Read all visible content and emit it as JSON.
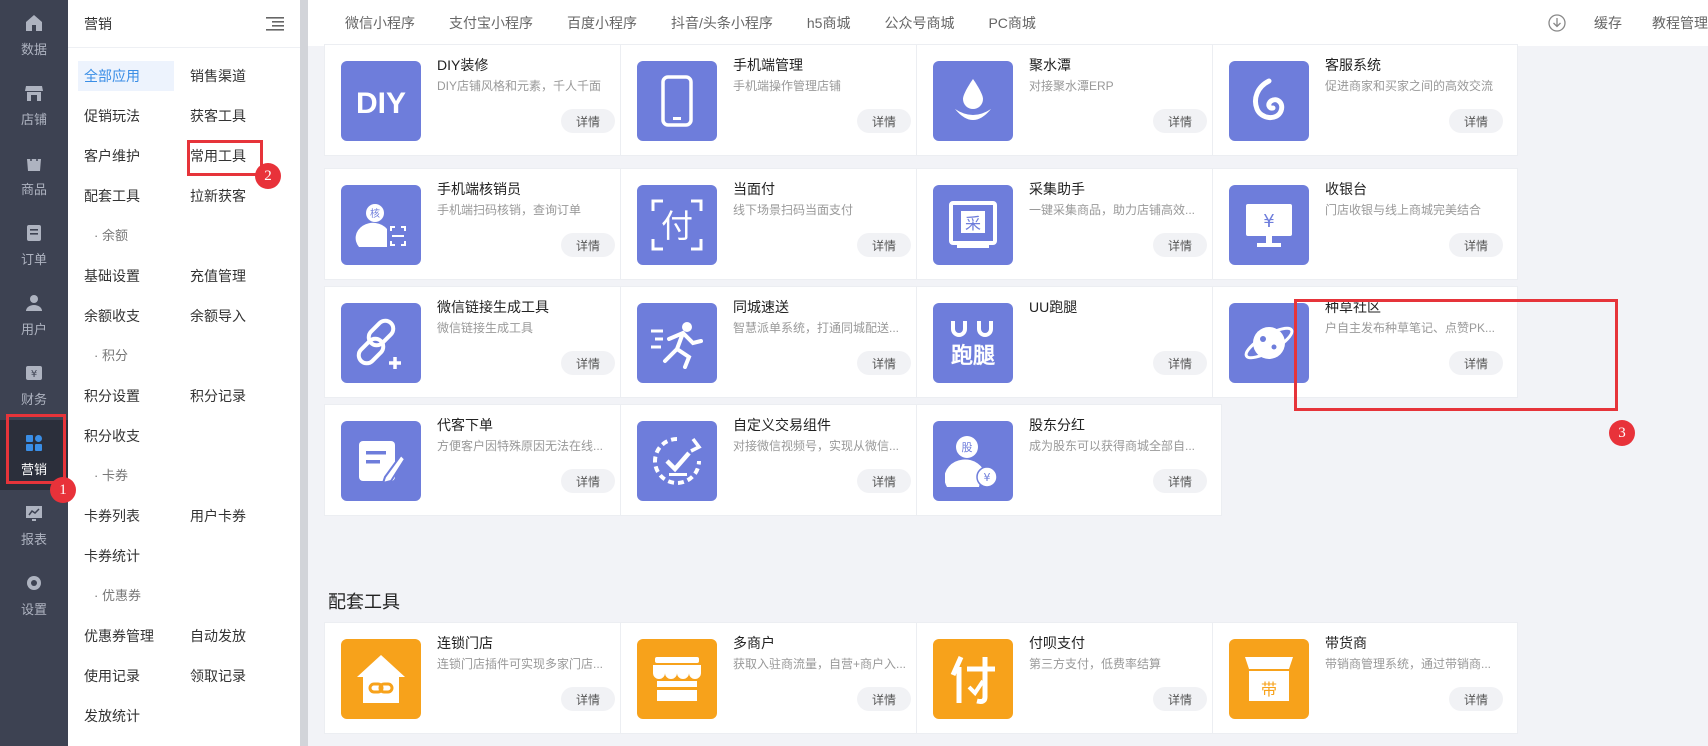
{
  "rail": {
    "items": [
      {
        "label": "数据",
        "icon": "home-icon"
      },
      {
        "label": "店铺",
        "icon": "store-icon"
      },
      {
        "label": "商品",
        "icon": "bag-icon"
      },
      {
        "label": "订单",
        "icon": "order-icon"
      },
      {
        "label": "用户",
        "icon": "user-icon"
      },
      {
        "label": "财务",
        "icon": "finance-icon"
      },
      {
        "label": "营销",
        "icon": "apps-icon",
        "active": true
      },
      {
        "label": "报表",
        "icon": "report-icon"
      },
      {
        "label": "设置",
        "icon": "gear-icon"
      }
    ]
  },
  "submenu": {
    "title": "营销",
    "rows": [
      [
        "全部应用",
        "销售渠道"
      ],
      [
        "促销玩法",
        "获客工具"
      ],
      [
        "客户维护",
        "常用工具"
      ],
      [
        "配套工具",
        "拉新获客"
      ],
      {
        "group": "· 余额"
      },
      [
        "基础设置",
        "充值管理"
      ],
      [
        "余额收支",
        "余额导入"
      ],
      {
        "group": "· 积分"
      },
      [
        "积分设置",
        "积分记录"
      ],
      [
        "积分收支",
        ""
      ],
      {
        "group": "· 卡券"
      },
      [
        "卡券列表",
        "用户卡券"
      ],
      [
        "卡券统计",
        ""
      ],
      {
        "group": "· 优惠券"
      },
      [
        "优惠券管理",
        "自动发放"
      ],
      [
        "使用记录",
        "领取记录"
      ],
      [
        "发放统计",
        ""
      ]
    ]
  },
  "topbar": {
    "tabs": [
      "微信小程序",
      "支付宝小程序",
      "百度小程序",
      "抖音/头条小程序",
      "h5商城",
      "公众号商城",
      "PC商城"
    ],
    "cache": "缓存",
    "tutorial": "教程管理"
  },
  "detail_label": "详情",
  "cards": [
    {
      "title": "DIY装修",
      "desc": "DIY店铺风格和元素，千人千面",
      "icon": "diy-icon",
      "color": "blue"
    },
    {
      "title": "手机端管理",
      "desc": "手机端操作管理店铺",
      "icon": "phone-icon",
      "color": "blue"
    },
    {
      "title": "聚水潭",
      "desc": "对接聚水潭ERP",
      "icon": "water-drop-icon",
      "color": "blue"
    },
    {
      "title": "客服系统",
      "desc": "促进商家和买家之间的高效交流",
      "icon": "service-icon",
      "color": "blue"
    },
    {
      "title": "手机端核销员",
      "desc": "手机端扫码核销，查询订单",
      "icon": "verifier-icon",
      "color": "blue"
    },
    {
      "title": "当面付",
      "desc": "线下场景扫码当面支付",
      "icon": "pay-icon",
      "color": "blue"
    },
    {
      "title": "采集助手",
      "desc": "一键采集商品，助力店铺高效...",
      "icon": "collect-icon",
      "color": "blue"
    },
    {
      "title": "收银台",
      "desc": "门店收银与线上商城完美结合",
      "icon": "cashier-icon",
      "color": "blue"
    },
    {
      "title": "微信链接生成工具",
      "desc": "微信链接生成工具",
      "icon": "link-icon",
      "color": "blue"
    },
    {
      "title": "同城速送",
      "desc": "智慧派单系统，打通同城配送...",
      "icon": "runner-icon",
      "color": "blue"
    },
    {
      "title": "UU跑腿",
      "desc": "",
      "icon": "uu-icon",
      "color": "blue"
    },
    {
      "title": "种草社区",
      "desc": "户自主发布种草笔记、点赞PK...",
      "icon": "planet-icon",
      "color": "blue"
    },
    {
      "title": "代客下单",
      "desc": "方便客户因特殊原因无法在线...",
      "icon": "edit-icon",
      "color": "blue"
    },
    {
      "title": "自定义交易组件",
      "desc": "对接微信视频号，实现从微信...",
      "icon": "custom-trade-icon",
      "color": "blue"
    },
    {
      "title": "股东分红",
      "desc": "成为股东可以获得商城全部自...",
      "icon": "shareholder-icon",
      "color": "blue"
    }
  ],
  "section2": {
    "title": "配套工具",
    "cards": [
      {
        "title": "连锁门店",
        "desc": "连锁门店插件可实现多家门店...",
        "icon": "chain-store-icon",
        "color": "orange"
      },
      {
        "title": "多商户",
        "desc": "获取入驻商流量，自营+商户入...",
        "icon": "merchant-icon",
        "color": "orange"
      },
      {
        "title": "付呗支付",
        "desc": "第三方支付，低费率结算",
        "icon": "fubei-icon",
        "color": "orange"
      },
      {
        "title": "带货商",
        "desc": "带销商管理系统，通过带销商...",
        "icon": "seller-icon",
        "color": "orange"
      }
    ]
  },
  "annotations": {
    "b1": "1",
    "b2": "2",
    "b3": "3"
  },
  "colors": {
    "rail": "#3d4252",
    "accent": "#3a8ee6",
    "icon_blue": "#6e7ddb",
    "icon_orange": "#f7a21b",
    "highlight": "#e6343a"
  }
}
